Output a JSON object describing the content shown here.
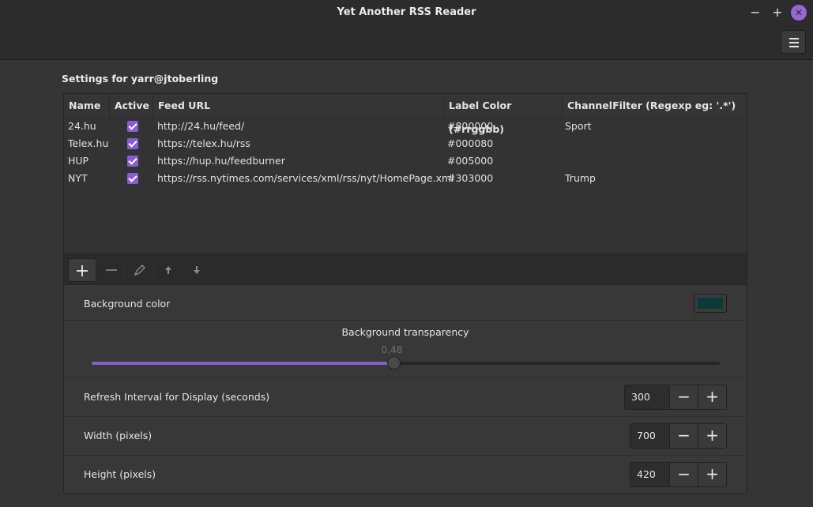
{
  "window": {
    "title": "Yet Another RSS Reader",
    "minimize_symbol": "−",
    "maximize_symbol": "+",
    "close_symbol": "✕"
  },
  "settings": {
    "heading": "Settings for yarr@jtoberling"
  },
  "feeds": {
    "columns": [
      "Name",
      "Active",
      "Feed URL",
      "Label Color (#rrggbb)",
      "ChannelFilter (Regexp eg: '.*')"
    ],
    "rows": [
      {
        "name": "24.hu",
        "active": true,
        "url": "http://24.hu/feed/",
        "color": "#800000",
        "filter": "Sport"
      },
      {
        "name": "Telex.hu",
        "active": true,
        "url": "https://telex.hu/rss",
        "color": "#000080",
        "filter": ""
      },
      {
        "name": "HUP",
        "active": true,
        "url": "https://hup.hu/feedburner",
        "color": "#005000",
        "filter": ""
      },
      {
        "name": "NYT",
        "active": true,
        "url": "https://rss.nytimes.com/services/xml/rss/nyt/HomePage.xml",
        "color": "#303000",
        "filter": "Trump"
      }
    ],
    "toolbar": {
      "add_icon": "plus-icon",
      "remove_icon": "minus-icon",
      "edit_icon": "pencil-icon",
      "up_icon": "arrow-up-icon",
      "down_icon": "arrow-down-icon"
    }
  },
  "background_color": {
    "label": "Background color",
    "value": "#0c3a38"
  },
  "transparency": {
    "label": "Background transparency",
    "value": "0,48",
    "fraction": 0.48
  },
  "refresh": {
    "label": "Refresh Interval for Display (seconds)",
    "value": "300"
  },
  "width": {
    "label": "Width (pixels)",
    "value": "700"
  },
  "height": {
    "label": "Height (pixels)",
    "value": "420"
  },
  "spin_symbols": {
    "minus": "−",
    "plus": "+"
  },
  "accent_color": "#8a5cd1"
}
